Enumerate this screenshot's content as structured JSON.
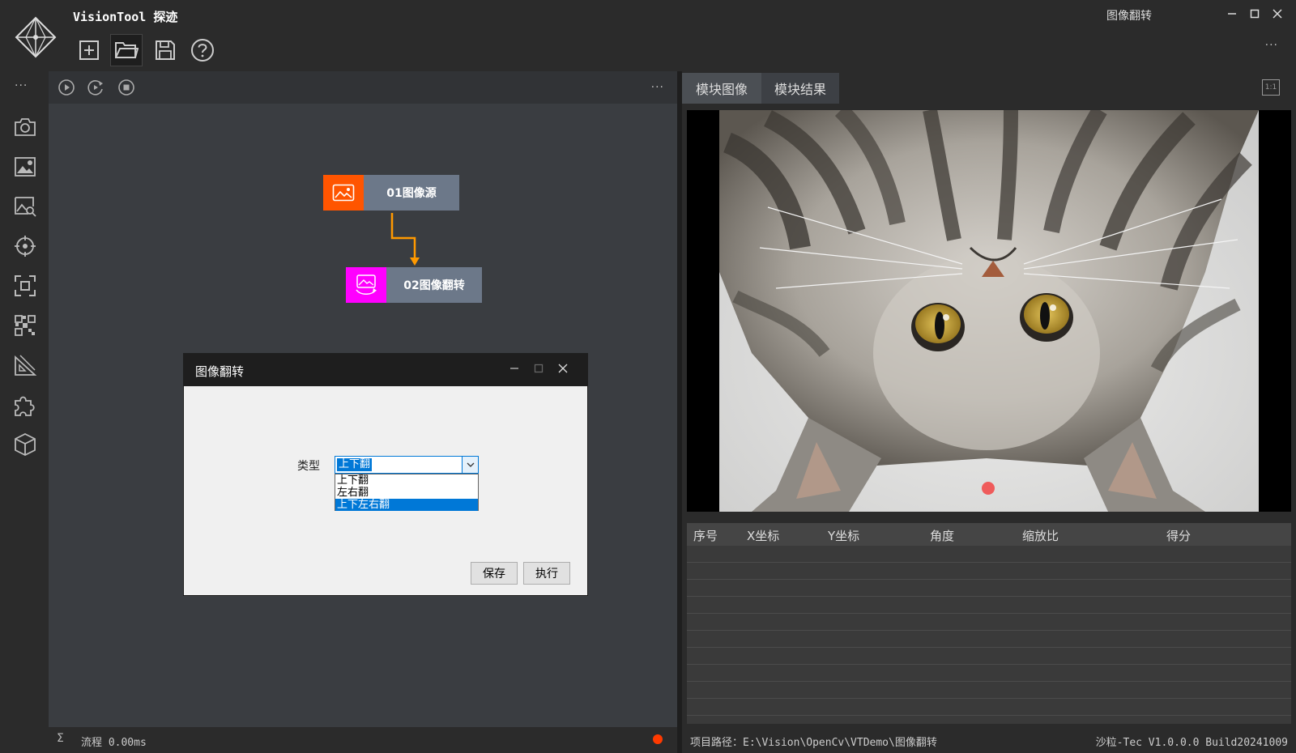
{
  "app": {
    "title": "VisionTool 探迹",
    "window_title": "图像翻转",
    "more_label": "···"
  },
  "toolbar": {
    "buttons": [
      "new-file-icon",
      "open-folder-icon",
      "save-icon",
      "help-icon"
    ]
  },
  "sidebar": {
    "more_label": "···",
    "items": [
      "camera-icon",
      "image-settings-icon",
      "image-search-icon",
      "target-icon",
      "focus-frame-icon",
      "grid-pattern-icon",
      "ruler-icon",
      "puzzle-icon",
      "cube-icon"
    ]
  },
  "flow": {
    "controls": [
      "run-icon",
      "loop-run-icon",
      "stop-icon"
    ],
    "more_label": "···",
    "nodes": [
      {
        "label": "01图像源",
        "color": "#ff5500"
      },
      {
        "label": "02图像翻转",
        "color": "#ff00ff"
      }
    ],
    "connector_color": "#ff9900",
    "status_symbol": "Σ",
    "status": "流程 0.00ms",
    "status_indicator_color": "#ff3a00"
  },
  "dialog": {
    "title": "图像翻转",
    "type_label": "类型",
    "selected": "上下翻",
    "options": [
      "上下翻",
      "左右翻",
      "上下左右翻"
    ],
    "highlighted_option": "上下左右翻",
    "save_label": "保存",
    "execute_label": "执行"
  },
  "right": {
    "tabs": [
      {
        "label": "模块图像",
        "active": true
      },
      {
        "label": "模块结果",
        "active": false
      }
    ],
    "ratio_label": "1:1",
    "table": {
      "columns": [
        "序号",
        "X坐标",
        "Y坐标",
        "角度",
        "缩放比",
        "得分"
      ],
      "rows": []
    },
    "project_path": "项目路径：E:\\Vision\\OpenCv\\VTDemo\\图像翻转",
    "version": "沙粒-Tec V1.0.0.0 Build20241009"
  }
}
